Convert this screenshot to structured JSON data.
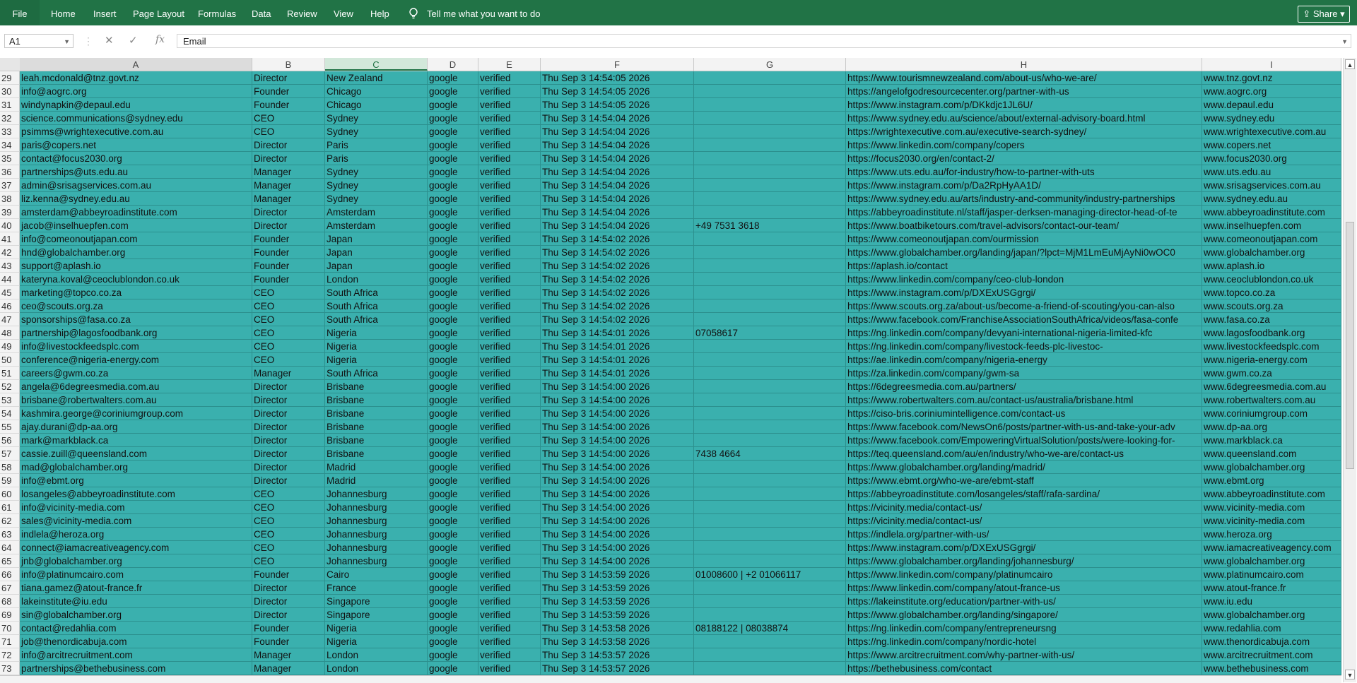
{
  "ribbon": {
    "file": "File",
    "tabs": [
      "Home",
      "Insert",
      "Page Layout",
      "Formulas",
      "Data",
      "Review",
      "View",
      "Help"
    ],
    "tell_me": "Tell me what you want to do",
    "share": "Share"
  },
  "formula_bar": {
    "name_box": "A1",
    "formula": "Email",
    "cancel_icon": "✕",
    "enter_icon": "✓",
    "fx_icon": "fx"
  },
  "columns": [
    "A",
    "B",
    "C",
    "D",
    "E",
    "F",
    "G",
    "H",
    "I"
  ],
  "selected_column": "C",
  "colors": {
    "ribbon": "#217346",
    "cells": "#3ab0ae"
  },
  "rows": [
    {
      "n": "29",
      "a": "leah.mcdonald@tnz.govt.nz",
      "b": "Director",
      "c": "New Zealand",
      "d": "google",
      "e": "verified",
      "f": "Thu Sep  3 14:54:05 2026",
      "g": "",
      "h": "https://www.tourismnewzealand.com/about-us/who-we-are/",
      "i": "www.tnz.govt.nz"
    },
    {
      "n": "30",
      "a": "info@aogrc.org",
      "b": "Founder",
      "c": "Chicago",
      "d": "google",
      "e": "verified",
      "f": "Thu Sep  3 14:54:05 2026",
      "g": "",
      "h": "https://angelofgodresourcecenter.org/partner-with-us",
      "i": "www.aogrc.org"
    },
    {
      "n": "31",
      "a": "windynapkin@depaul.edu",
      "b": "Founder",
      "c": "Chicago",
      "d": "google",
      "e": "verified",
      "f": "Thu Sep  3 14:54:05 2026",
      "g": "",
      "h": "https://www.instagram.com/p/DKkdjc1JL6U/",
      "i": "www.depaul.edu"
    },
    {
      "n": "32",
      "a": "science.communications@sydney.edu",
      "b": "CEO",
      "c": "Sydney",
      "d": "google",
      "e": "verified",
      "f": "Thu Sep  3 14:54:04 2026",
      "g": "",
      "h": "https://www.sydney.edu.au/science/about/external-advisory-board.html",
      "i": "www.sydney.edu"
    },
    {
      "n": "33",
      "a": "psimms@wrightexecutive.com.au",
      "b": "CEO",
      "c": "Sydney",
      "d": "google",
      "e": "verified",
      "f": "Thu Sep  3 14:54:04 2026",
      "g": "",
      "h": "https://wrightexecutive.com.au/executive-search-sydney/",
      "i": "www.wrightexecutive.com.au"
    },
    {
      "n": "34",
      "a": "paris@copers.net",
      "b": "Director",
      "c": "Paris",
      "d": "google",
      "e": "verified",
      "f": "Thu Sep  3 14:54:04 2026",
      "g": "",
      "h": "https://www.linkedin.com/company/copers",
      "i": "www.copers.net"
    },
    {
      "n": "35",
      "a": "contact@focus2030.org",
      "b": "Director",
      "c": "Paris",
      "d": "google",
      "e": "verified",
      "f": "Thu Sep  3 14:54:04 2026",
      "g": "",
      "h": "https://focus2030.org/en/contact-2/",
      "i": "www.focus2030.org"
    },
    {
      "n": "36",
      "a": "partnerships@uts.edu.au",
      "b": "Manager",
      "c": "Sydney",
      "d": "google",
      "e": "verified",
      "f": "Thu Sep  3 14:54:04 2026",
      "g": "",
      "h": "https://www.uts.edu.au/for-industry/how-to-partner-with-uts",
      "i": "www.uts.edu.au"
    },
    {
      "n": "37",
      "a": "admin@srisagservices.com.au",
      "b": "Manager",
      "c": "Sydney",
      "d": "google",
      "e": "verified",
      "f": "Thu Sep  3 14:54:04 2026",
      "g": "",
      "h": "https://www.instagram.com/p/Da2RpHyAA1D/",
      "i": "www.srisagservices.com.au"
    },
    {
      "n": "38",
      "a": "liz.kenna@sydney.edu.au",
      "b": "Manager",
      "c": "Sydney",
      "d": "google",
      "e": "verified",
      "f": "Thu Sep  3 14:54:04 2026",
      "g": "",
      "h": "https://www.sydney.edu.au/arts/industry-and-community/industry-partnerships",
      "i": "www.sydney.edu.au"
    },
    {
      "n": "39",
      "a": "amsterdam@abbeyroadinstitute.com",
      "b": "Director",
      "c": "Amsterdam",
      "d": "google",
      "e": "verified",
      "f": "Thu Sep  3 14:54:04 2026",
      "g": "",
      "h": "https://abbeyroadinstitute.nl/staff/jasper-derksen-managing-director-head-of-te",
      "i": "www.abbeyroadinstitute.com"
    },
    {
      "n": "40",
      "a": "jacob@inselhuepfen.com",
      "b": "Director",
      "c": "Amsterdam",
      "d": "google",
      "e": "verified",
      "f": "Thu Sep  3 14:54:04 2026",
      "g": "+49 7531 3618",
      "h": "https://www.boatbiketours.com/travel-advisors/contact-our-team/",
      "i": "www.inselhuepfen.com"
    },
    {
      "n": "41",
      "a": "info@comeonoutjapan.com",
      "b": "Founder",
      "c": "Japan",
      "d": "google",
      "e": "verified",
      "f": "Thu Sep  3 14:54:02 2026",
      "g": "",
      "h": "https://www.comeonoutjapan.com/ourmission",
      "i": "www.comeonoutjapan.com"
    },
    {
      "n": "42",
      "a": "hnd@globalchamber.org",
      "b": "Founder",
      "c": "Japan",
      "d": "google",
      "e": "verified",
      "f": "Thu Sep  3 14:54:02 2026",
      "g": "",
      "h": "https://www.globalchamber.org/landing/japan/?lpct=MjM1LmEuMjAyNi0wOC0",
      "i": "www.globalchamber.org"
    },
    {
      "n": "43",
      "a": "support@aplash.io",
      "b": "Founder",
      "c": "Japan",
      "d": "google",
      "e": "verified",
      "f": "Thu Sep  3 14:54:02 2026",
      "g": "",
      "h": "https://aplash.io/contact",
      "i": "www.aplash.io"
    },
    {
      "n": "44",
      "a": "kateryna.koval@ceoclublondon.co.uk",
      "b": "Founder",
      "c": "London",
      "d": "google",
      "e": "verified",
      "f": "Thu Sep  3 14:54:02 2026",
      "g": "",
      "h": "https://www.linkedin.com/company/ceo-club-london",
      "i": "www.ceoclublondon.co.uk"
    },
    {
      "n": "45",
      "a": "marketing@topco.co.za",
      "b": "CEO",
      "c": "South Africa",
      "d": "google",
      "e": "verified",
      "f": "Thu Sep  3 14:54:02 2026",
      "g": "",
      "h": "https://www.instagram.com/p/DXExUSGgrgi/",
      "i": "www.topco.co.za"
    },
    {
      "n": "46",
      "a": "ceo@scouts.org.za",
      "b": "CEO",
      "c": "South Africa",
      "d": "google",
      "e": "verified",
      "f": "Thu Sep  3 14:54:02 2026",
      "g": "",
      "h": "https://www.scouts.org.za/about-us/become-a-friend-of-scouting/you-can-also",
      "i": "www.scouts.org.za"
    },
    {
      "n": "47",
      "a": "sponsorships@fasa.co.za",
      "b": "CEO",
      "c": "South Africa",
      "d": "google",
      "e": "verified",
      "f": "Thu Sep  3 14:54:02 2026",
      "g": "",
      "h": "https://www.facebook.com/FranchiseAssociationSouthAfrica/videos/fasa-confe",
      "i": "www.fasa.co.za"
    },
    {
      "n": "48",
      "a": "partnership@lagosfoodbank.org",
      "b": "CEO",
      "c": "Nigeria",
      "d": "google",
      "e": "verified",
      "f": "Thu Sep  3 14:54:01 2026",
      "g": "07058617",
      "h": "https://ng.linkedin.com/company/devyani-international-nigeria-limited-kfc",
      "i": "www.lagosfoodbank.org"
    },
    {
      "n": "49",
      "a": "info@livestockfeedsplc.com",
      "b": "CEO",
      "c": "Nigeria",
      "d": "google",
      "e": "verified",
      "f": "Thu Sep  3 14:54:01 2026",
      "g": "",
      "h": "https://ng.linkedin.com/company/livestock-feeds-plc-livestoc-",
      "i": "www.livestockfeedsplc.com"
    },
    {
      "n": "50",
      "a": "conference@nigeria-energy.com",
      "b": "CEO",
      "c": "Nigeria",
      "d": "google",
      "e": "verified",
      "f": "Thu Sep  3 14:54:01 2026",
      "g": "",
      "h": "https://ae.linkedin.com/company/nigeria-energy",
      "i": "www.nigeria-energy.com"
    },
    {
      "n": "51",
      "a": "careers@gwm.co.za",
      "b": "Manager",
      "c": "South Africa",
      "d": "google",
      "e": "verified",
      "f": "Thu Sep  3 14:54:01 2026",
      "g": "",
      "h": "https://za.linkedin.com/company/gwm-sa",
      "i": "www.gwm.co.za"
    },
    {
      "n": "52",
      "a": "angela@6degreesmedia.com.au",
      "b": "Director",
      "c": "Brisbane",
      "d": "google",
      "e": "verified",
      "f": "Thu Sep  3 14:54:00 2026",
      "g": "",
      "h": "https://6degreesmedia.com.au/partners/",
      "i": "www.6degreesmedia.com.au"
    },
    {
      "n": "53",
      "a": "brisbane@robertwalters.com.au",
      "b": "Director",
      "c": "Brisbane",
      "d": "google",
      "e": "verified",
      "f": "Thu Sep  3 14:54:00 2026",
      "g": "",
      "h": "https://www.robertwalters.com.au/contact-us/australia/brisbane.html",
      "i": "www.robertwalters.com.au"
    },
    {
      "n": "54",
      "a": "kashmira.george@coriniumgroup.com",
      "b": "Director",
      "c": "Brisbane",
      "d": "google",
      "e": "verified",
      "f": "Thu Sep  3 14:54:00 2026",
      "g": "",
      "h": "https://ciso-bris.coriniumintelligence.com/contact-us",
      "i": "www.coriniumgroup.com"
    },
    {
      "n": "55",
      "a": "ajay.durani@dp-aa.org",
      "b": "Director",
      "c": "Brisbane",
      "d": "google",
      "e": "verified",
      "f": "Thu Sep  3 14:54:00 2026",
      "g": "",
      "h": "https://www.facebook.com/NewsOn6/posts/partner-with-us-and-take-your-adv",
      "i": "www.dp-aa.org"
    },
    {
      "n": "56",
      "a": "mark@markblack.ca",
      "b": "Director",
      "c": "Brisbane",
      "d": "google",
      "e": "verified",
      "f": "Thu Sep  3 14:54:00 2026",
      "g": "",
      "h": "https://www.facebook.com/EmpoweringVirtualSolution/posts/were-looking-for-",
      "i": "www.markblack.ca"
    },
    {
      "n": "57",
      "a": "cassie.zuill@queensland.com",
      "b": "Director",
      "c": "Brisbane",
      "d": "google",
      "e": "verified",
      "f": "Thu Sep  3 14:54:00 2026",
      "g": "7438 4664",
      "h": "https://teq.queensland.com/au/en/industry/who-we-are/contact-us",
      "i": "www.queensland.com"
    },
    {
      "n": "58",
      "a": "mad@globalchamber.org",
      "b": "Director",
      "c": "Madrid",
      "d": "google",
      "e": "verified",
      "f": "Thu Sep  3 14:54:00 2026",
      "g": "",
      "h": "https://www.globalchamber.org/landing/madrid/",
      "i": "www.globalchamber.org"
    },
    {
      "n": "59",
      "a": "info@ebmt.org",
      "b": "Director",
      "c": "Madrid",
      "d": "google",
      "e": "verified",
      "f": "Thu Sep  3 14:54:00 2026",
      "g": "",
      "h": "https://www.ebmt.org/who-we-are/ebmt-staff",
      "i": "www.ebmt.org"
    },
    {
      "n": "60",
      "a": "losangeles@abbeyroadinstitute.com",
      "b": "CEO",
      "c": "Johannesburg",
      "d": "google",
      "e": "verified",
      "f": "Thu Sep  3 14:54:00 2026",
      "g": "",
      "h": "https://abbeyroadinstitute.com/losangeles/staff/rafa-sardina/",
      "i": "www.abbeyroadinstitute.com"
    },
    {
      "n": "61",
      "a": "info@vicinity-media.com",
      "b": "CEO",
      "c": "Johannesburg",
      "d": "google",
      "e": "verified",
      "f": "Thu Sep  3 14:54:00 2026",
      "g": "",
      "h": "https://vicinity.media/contact-us/",
      "i": "www.vicinity-media.com"
    },
    {
      "n": "62",
      "a": "sales@vicinity-media.com",
      "b": "CEO",
      "c": "Johannesburg",
      "d": "google",
      "e": "verified",
      "f": "Thu Sep  3 14:54:00 2026",
      "g": "",
      "h": "https://vicinity.media/contact-us/",
      "i": "www.vicinity-media.com"
    },
    {
      "n": "63",
      "a": "indlela@heroza.org",
      "b": "CEO",
      "c": "Johannesburg",
      "d": "google",
      "e": "verified",
      "f": "Thu Sep  3 14:54:00 2026",
      "g": "",
      "h": "https://indlela.org/partner-with-us/",
      "i": "www.heroza.org"
    },
    {
      "n": "64",
      "a": "connect@iamacreativeagency.com",
      "b": "CEO",
      "c": "Johannesburg",
      "d": "google",
      "e": "verified",
      "f": "Thu Sep  3 14:54:00 2026",
      "g": "",
      "h": "https://www.instagram.com/p/DXExUSGgrgi/",
      "i": "www.iamacreativeagency.com"
    },
    {
      "n": "65",
      "a": "jnb@globalchamber.org",
      "b": "CEO",
      "c": "Johannesburg",
      "d": "google",
      "e": "verified",
      "f": "Thu Sep  3 14:54:00 2026",
      "g": "",
      "h": "https://www.globalchamber.org/landing/johannesburg/",
      "i": "www.globalchamber.org"
    },
    {
      "n": "66",
      "a": "info@platinumcairo.com",
      "b": "Founder",
      "c": "Cairo",
      "d": "google",
      "e": "verified",
      "f": "Thu Sep  3 14:53:59 2026",
      "g": "01008600 | +2 01066117",
      "h": "https://www.linkedin.com/company/platinumcairo",
      "i": "www.platinumcairo.com"
    },
    {
      "n": "67",
      "a": "tiana.gamez@atout-france.fr",
      "b": "Director",
      "c": "France",
      "d": "google",
      "e": "verified",
      "f": "Thu Sep  3 14:53:59 2026",
      "g": "",
      "h": "https://www.linkedin.com/company/atout-france-us",
      "i": "www.atout-france.fr"
    },
    {
      "n": "68",
      "a": "lakeinstitute@iu.edu",
      "b": "Director",
      "c": "Singapore",
      "d": "google",
      "e": "verified",
      "f": "Thu Sep  3 14:53:59 2026",
      "g": "",
      "h": "https://lakeinstitute.org/education/partner-with-us/",
      "i": "www.iu.edu"
    },
    {
      "n": "69",
      "a": "sin@globalchamber.org",
      "b": "Director",
      "c": "Singapore",
      "d": "google",
      "e": "verified",
      "f": "Thu Sep  3 14:53:59 2026",
      "g": "",
      "h": "https://www.globalchamber.org/landing/singapore/",
      "i": "www.globalchamber.org"
    },
    {
      "n": "70",
      "a": "contact@redahlia.com",
      "b": "Founder",
      "c": "Nigeria",
      "d": "google",
      "e": "verified",
      "f": "Thu Sep  3 14:53:58 2026",
      "g": "08188122 | 08038874",
      "h": "https://ng.linkedin.com/company/entrepreneursng",
      "i": "www.redahlia.com"
    },
    {
      "n": "71",
      "a": "job@thenordicabuja.com",
      "b": "Founder",
      "c": "Nigeria",
      "d": "google",
      "e": "verified",
      "f": "Thu Sep  3 14:53:58 2026",
      "g": "",
      "h": "https://ng.linkedin.com/company/nordic-hotel",
      "i": "www.thenordicabuja.com"
    },
    {
      "n": "72",
      "a": "info@arcitrecruitment.com",
      "b": "Manager",
      "c": "London",
      "d": "google",
      "e": "verified",
      "f": "Thu Sep  3 14:53:57 2026",
      "g": "",
      "h": "https://www.arcitrecruitment.com/why-partner-with-us/",
      "i": "www.arcitrecruitment.com"
    },
    {
      "n": "73",
      "a": "partnerships@bethebusiness.com",
      "b": "Manager",
      "c": "London",
      "d": "google",
      "e": "verified",
      "f": "Thu Sep  3 14:53:57 2026",
      "g": "",
      "h": "https://bethebusiness.com/contact",
      "i": "www.bethebusiness.com"
    }
  ]
}
